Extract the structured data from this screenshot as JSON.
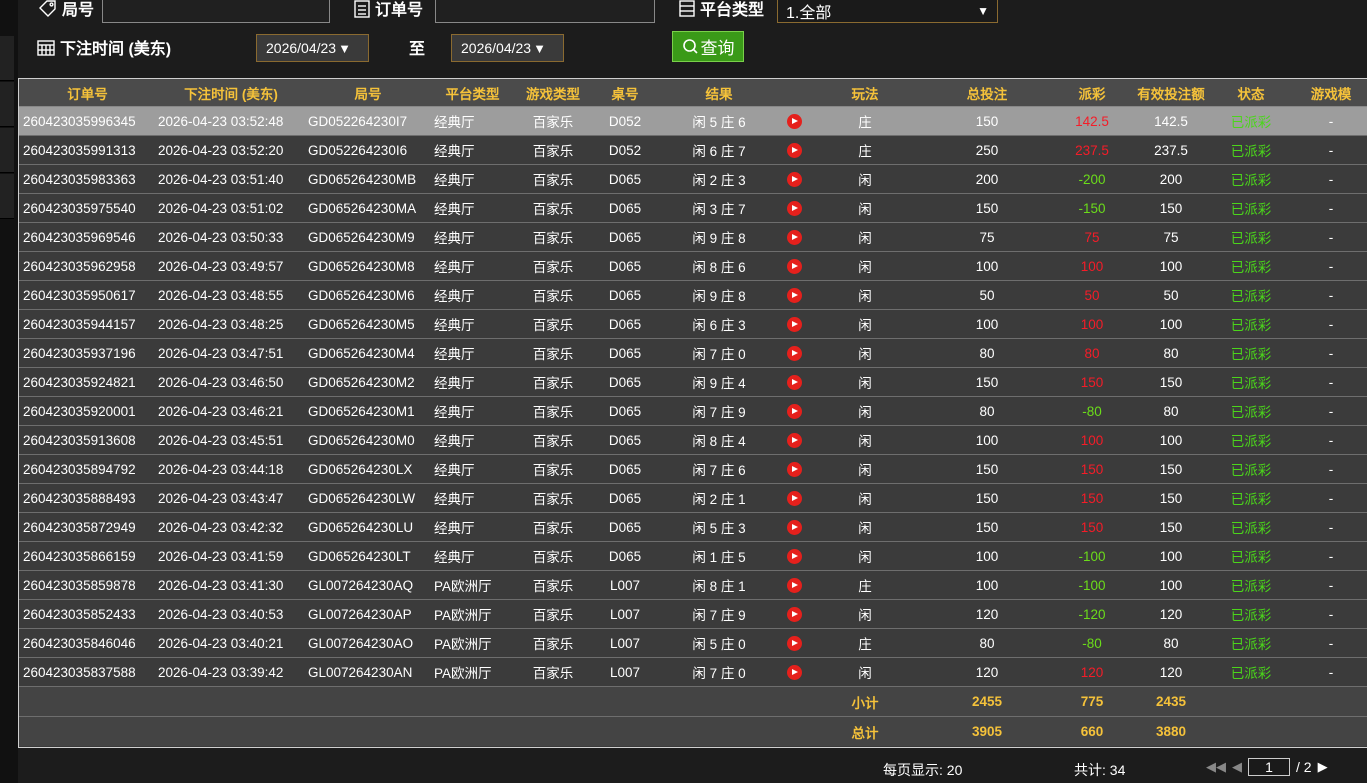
{
  "filters": {
    "round_label": "局号",
    "round_value": "",
    "order_label": "订单号",
    "order_value": "",
    "platform_label": "平台类型",
    "platform_value": "1.全部",
    "time_label": "下注时间 (美东)",
    "date_from": "2026/04/23",
    "to_label": "至",
    "date_to": "2026/04/23",
    "query_label": "查询"
  },
  "table": {
    "headers": [
      "订单号",
      "下注时间 (美东)",
      "局号",
      "平台类型",
      "游戏类型",
      "桌号",
      "结果",
      "",
      "玩法",
      "总投注",
      "派彩",
      "有效投注额",
      "状态",
      "游戏模"
    ],
    "rows": [
      {
        "order": "260423035996345",
        "time": "2026-04-23 03:52:48",
        "round": "GD052264230I7",
        "platform": "经典厅",
        "game": "百家乐",
        "table": "D052",
        "result": "闲 5 庄 6",
        "bet_type": "庄",
        "bet": "150",
        "payout": "142.5",
        "payout_sign": "pos",
        "valid": "142.5",
        "status": "已派彩",
        "mode": "-"
      },
      {
        "order": "260423035991313",
        "time": "2026-04-23 03:52:20",
        "round": "GD052264230I6",
        "platform": "经典厅",
        "game": "百家乐",
        "table": "D052",
        "result": "闲 6 庄 7",
        "bet_type": "庄",
        "bet": "250",
        "payout": "237.5",
        "payout_sign": "pos",
        "valid": "237.5",
        "status": "已派彩",
        "mode": "-"
      },
      {
        "order": "260423035983363",
        "time": "2026-04-23 03:51:40",
        "round": "GD065264230MB",
        "platform": "经典厅",
        "game": "百家乐",
        "table": "D065",
        "result": "闲 2 庄 3",
        "bet_type": "闲",
        "bet": "200",
        "payout": "-200",
        "payout_sign": "neg",
        "valid": "200",
        "status": "已派彩",
        "mode": "-"
      },
      {
        "order": "260423035975540",
        "time": "2026-04-23 03:51:02",
        "round": "GD065264230MA",
        "platform": "经典厅",
        "game": "百家乐",
        "table": "D065",
        "result": "闲 3 庄 7",
        "bet_type": "闲",
        "bet": "150",
        "payout": "-150",
        "payout_sign": "neg",
        "valid": "150",
        "status": "已派彩",
        "mode": "-"
      },
      {
        "order": "260423035969546",
        "time": "2026-04-23 03:50:33",
        "round": "GD065264230M9",
        "platform": "经典厅",
        "game": "百家乐",
        "table": "D065",
        "result": "闲 9 庄 8",
        "bet_type": "闲",
        "bet": "75",
        "payout": "75",
        "payout_sign": "pos",
        "valid": "75",
        "status": "已派彩",
        "mode": "-"
      },
      {
        "order": "260423035962958",
        "time": "2026-04-23 03:49:57",
        "round": "GD065264230M8",
        "platform": "经典厅",
        "game": "百家乐",
        "table": "D065",
        "result": "闲 8 庄 6",
        "bet_type": "闲",
        "bet": "100",
        "payout": "100",
        "payout_sign": "pos",
        "valid": "100",
        "status": "已派彩",
        "mode": "-"
      },
      {
        "order": "260423035950617",
        "time": "2026-04-23 03:48:55",
        "round": "GD065264230M6",
        "platform": "经典厅",
        "game": "百家乐",
        "table": "D065",
        "result": "闲 9 庄 8",
        "bet_type": "闲",
        "bet": "50",
        "payout": "50",
        "payout_sign": "pos",
        "valid": "50",
        "status": "已派彩",
        "mode": "-"
      },
      {
        "order": "260423035944157",
        "time": "2026-04-23 03:48:25",
        "round": "GD065264230M5",
        "platform": "经典厅",
        "game": "百家乐",
        "table": "D065",
        "result": "闲 6 庄 3",
        "bet_type": "闲",
        "bet": "100",
        "payout": "100",
        "payout_sign": "pos",
        "valid": "100",
        "status": "已派彩",
        "mode": "-"
      },
      {
        "order": "260423035937196",
        "time": "2026-04-23 03:47:51",
        "round": "GD065264230M4",
        "platform": "经典厅",
        "game": "百家乐",
        "table": "D065",
        "result": "闲 7 庄 0",
        "bet_type": "闲",
        "bet": "80",
        "payout": "80",
        "payout_sign": "pos",
        "valid": "80",
        "status": "已派彩",
        "mode": "-"
      },
      {
        "order": "260423035924821",
        "time": "2026-04-23 03:46:50",
        "round": "GD065264230M2",
        "platform": "经典厅",
        "game": "百家乐",
        "table": "D065",
        "result": "闲 9 庄 4",
        "bet_type": "闲",
        "bet": "150",
        "payout": "150",
        "payout_sign": "pos",
        "valid": "150",
        "status": "已派彩",
        "mode": "-"
      },
      {
        "order": "260423035920001",
        "time": "2026-04-23 03:46:21",
        "round": "GD065264230M1",
        "platform": "经典厅",
        "game": "百家乐",
        "table": "D065",
        "result": "闲 7 庄 9",
        "bet_type": "闲",
        "bet": "80",
        "payout": "-80",
        "payout_sign": "neg",
        "valid": "80",
        "status": "已派彩",
        "mode": "-"
      },
      {
        "order": "260423035913608",
        "time": "2026-04-23 03:45:51",
        "round": "GD065264230M0",
        "platform": "经典厅",
        "game": "百家乐",
        "table": "D065",
        "result": "闲 8 庄 4",
        "bet_type": "闲",
        "bet": "100",
        "payout": "100",
        "payout_sign": "pos",
        "valid": "100",
        "status": "已派彩",
        "mode": "-"
      },
      {
        "order": "260423035894792",
        "time": "2026-04-23 03:44:18",
        "round": "GD065264230LX",
        "platform": "经典厅",
        "game": "百家乐",
        "table": "D065",
        "result": "闲 7 庄 6",
        "bet_type": "闲",
        "bet": "150",
        "payout": "150",
        "payout_sign": "pos",
        "valid": "150",
        "status": "已派彩",
        "mode": "-"
      },
      {
        "order": "260423035888493",
        "time": "2026-04-23 03:43:47",
        "round": "GD065264230LW",
        "platform": "经典厅",
        "game": "百家乐",
        "table": "D065",
        "result": "闲 2 庄 1",
        "bet_type": "闲",
        "bet": "150",
        "payout": "150",
        "payout_sign": "pos",
        "valid": "150",
        "status": "已派彩",
        "mode": "-"
      },
      {
        "order": "260423035872949",
        "time": "2026-04-23 03:42:32",
        "round": "GD065264230LU",
        "platform": "经典厅",
        "game": "百家乐",
        "table": "D065",
        "result": "闲 5 庄 3",
        "bet_type": "闲",
        "bet": "150",
        "payout": "150",
        "payout_sign": "pos",
        "valid": "150",
        "status": "已派彩",
        "mode": "-"
      },
      {
        "order": "260423035866159",
        "time": "2026-04-23 03:41:59",
        "round": "GD065264230LT",
        "platform": "经典厅",
        "game": "百家乐",
        "table": "D065",
        "result": "闲 1 庄 5",
        "bet_type": "闲",
        "bet": "100",
        "payout": "-100",
        "payout_sign": "neg",
        "valid": "100",
        "status": "已派彩",
        "mode": "-"
      },
      {
        "order": "260423035859878",
        "time": "2026-04-23 03:41:30",
        "round": "GL007264230AQ",
        "platform": "PA欧洲厅",
        "game": "百家乐",
        "table": "L007",
        "result": "闲 8 庄 1",
        "bet_type": "庄",
        "bet": "100",
        "payout": "-100",
        "payout_sign": "neg",
        "valid": "100",
        "status": "已派彩",
        "mode": "-"
      },
      {
        "order": "260423035852433",
        "time": "2026-04-23 03:40:53",
        "round": "GL007264230AP",
        "platform": "PA欧洲厅",
        "game": "百家乐",
        "table": "L007",
        "result": "闲 7 庄 9",
        "bet_type": "闲",
        "bet": "120",
        "payout": "-120",
        "payout_sign": "neg",
        "valid": "120",
        "status": "已派彩",
        "mode": "-"
      },
      {
        "order": "260423035846046",
        "time": "2026-04-23 03:40:21",
        "round": "GL007264230AO",
        "platform": "PA欧洲厅",
        "game": "百家乐",
        "table": "L007",
        "result": "闲 5 庄 0",
        "bet_type": "庄",
        "bet": "80",
        "payout": "-80",
        "payout_sign": "neg",
        "valid": "80",
        "status": "已派彩",
        "mode": "-"
      },
      {
        "order": "260423035837588",
        "time": "2026-04-23 03:39:42",
        "round": "GL007264230AN",
        "platform": "PA欧洲厅",
        "game": "百家乐",
        "table": "L007",
        "result": "闲 7 庄 0",
        "bet_type": "闲",
        "bet": "120",
        "payout": "120",
        "payout_sign": "pos",
        "valid": "120",
        "status": "已派彩",
        "mode": "-"
      }
    ],
    "subtotal": {
      "label": "小计",
      "bet": "2455",
      "payout": "775",
      "valid": "2435"
    },
    "total": {
      "label": "总计",
      "bet": "3905",
      "payout": "660",
      "valid": "3880"
    }
  },
  "footer": {
    "per_page": "每页显示: 20",
    "total": "共计: 34",
    "page": "1",
    "total_pages": "/  2"
  },
  "colors": {
    "header_text": "#f5c23a",
    "payout_positive": "#f51c28",
    "payout_negative": "#6bdc1a",
    "status": "#4bd61a"
  }
}
